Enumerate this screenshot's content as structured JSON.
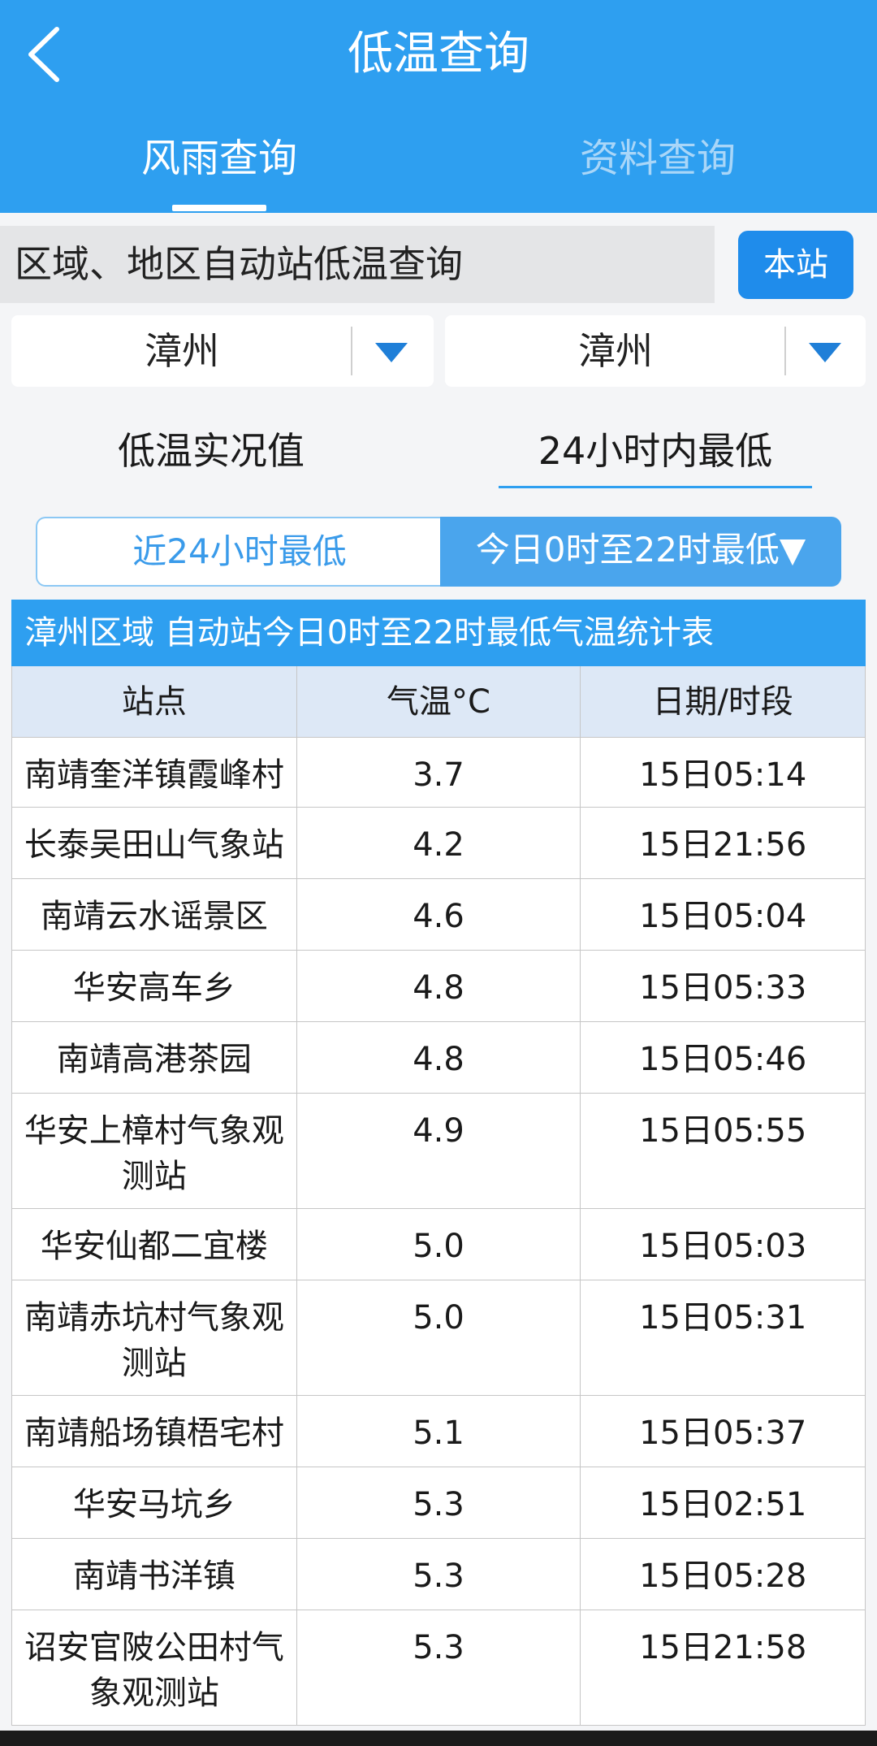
{
  "header": {
    "title": "低温查询",
    "tabs": [
      {
        "label": "风雨查询",
        "active": true
      },
      {
        "label": "资料查询",
        "active": false
      }
    ]
  },
  "query": {
    "label": "区域、地区自动站低温查询",
    "local_button": "本站"
  },
  "selects": [
    {
      "value": "漳州"
    },
    {
      "value": "漳州"
    }
  ],
  "options": {
    "realtime": "低温实况值",
    "min24h": "24小时内最低"
  },
  "segment": {
    "left": "近24小时最低",
    "right": "今日0时至22时最低▼"
  },
  "table": {
    "caption": "漳州区域 自动站今日0时至22时最低气温统计表",
    "columns": [
      "站点",
      "气温°C",
      "日期/时段"
    ],
    "rows": [
      {
        "station": "南靖奎洋镇霞峰村",
        "temp": "3.7",
        "time": "15日05:14"
      },
      {
        "station": "长泰吴田山气象站",
        "temp": "4.2",
        "time": "15日21:56"
      },
      {
        "station": "南靖云水谣景区",
        "temp": "4.6",
        "time": "15日05:04"
      },
      {
        "station": "华安高车乡",
        "temp": "4.8",
        "time": "15日05:33"
      },
      {
        "station": "南靖高港茶园",
        "temp": "4.8",
        "time": "15日05:46"
      },
      {
        "station": "华安上樟村气象观测站",
        "temp": "4.9",
        "time": "15日05:55"
      },
      {
        "station": "华安仙都二宜楼",
        "temp": "5.0",
        "time": "15日05:03"
      },
      {
        "station": "南靖赤坑村气象观测站",
        "temp": "5.0",
        "time": "15日05:31"
      },
      {
        "station": "南靖船场镇梧宅村",
        "temp": "5.1",
        "time": "15日05:37"
      },
      {
        "station": "华安马坑乡",
        "temp": "5.3",
        "time": "15日02:51"
      },
      {
        "station": "南靖书洋镇",
        "temp": "5.3",
        "time": "15日05:28"
      },
      {
        "station": "诏安官陂公田村气象观测站",
        "temp": "5.3",
        "time": "15日21:58"
      }
    ]
  },
  "colors": {
    "primary": "#2e9ff0",
    "button": "#1f8ceb",
    "header_row": "#dde8f6"
  }
}
